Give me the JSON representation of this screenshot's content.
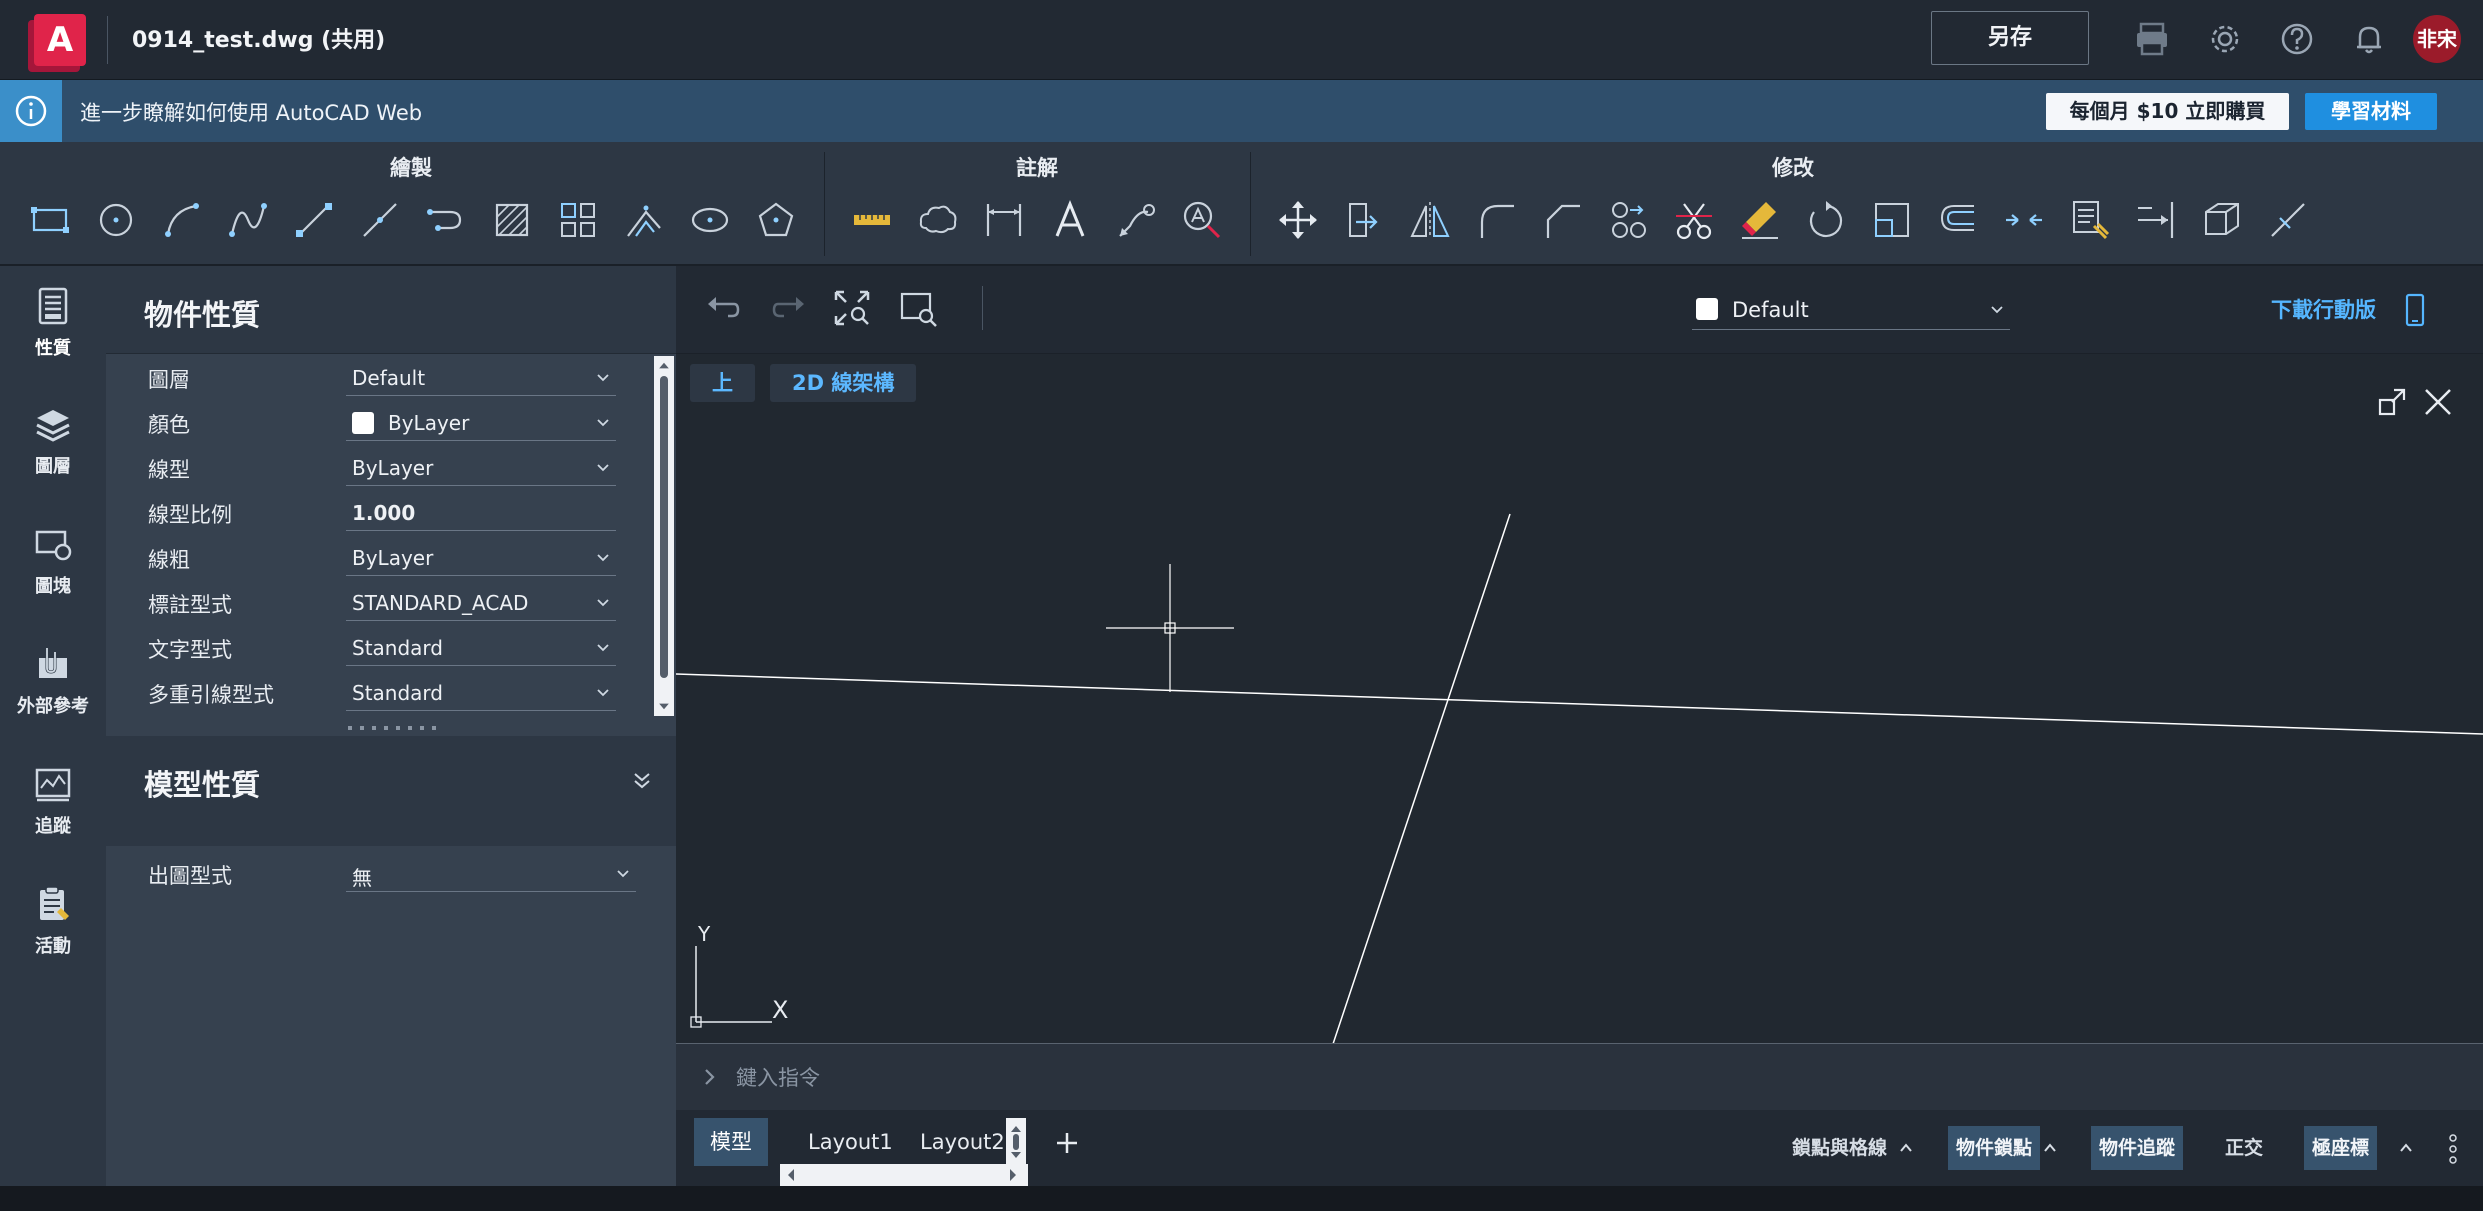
{
  "app": {
    "logo_letter": "A",
    "document_title": "0914_test.dwg (共用)",
    "save_as_label": "另存",
    "avatar_initials": "非宋"
  },
  "banner": {
    "text": "進一步瞭解如何使用 AutoCAD Web",
    "buy_label": "每個月 $10 立即購買",
    "learn_label": "學習材料"
  },
  "ribbon": {
    "groups": [
      {
        "title": "繪製",
        "tools": [
          "rectangle",
          "circle",
          "arc",
          "spline",
          "line",
          "ray",
          "polyline",
          "hatch",
          "array",
          "offset-trace",
          "ellipse",
          "polygon"
        ]
      },
      {
        "title": "註解",
        "tools": [
          "measure",
          "revision-cloud",
          "dimension",
          "text",
          "leader",
          "find-text"
        ]
      },
      {
        "title": "修改",
        "tools": [
          "move",
          "copy",
          "mirror",
          "fillet",
          "chamfer",
          "join",
          "trim",
          "erase",
          "rotate",
          "scale",
          "offset",
          "break",
          "match-properties",
          "extend",
          "3d-box",
          "explode"
        ]
      }
    ]
  },
  "rail": {
    "items": [
      {
        "label": "性質",
        "icon": "properties-icon"
      },
      {
        "label": "圖層",
        "icon": "layers-icon"
      },
      {
        "label": "圖塊",
        "icon": "blocks-icon"
      },
      {
        "label": "外部參考",
        "icon": "xref-icon"
      },
      {
        "label": "追蹤",
        "icon": "trace-icon"
      },
      {
        "label": "活動",
        "icon": "activity-icon"
      }
    ]
  },
  "properties": {
    "title": "物件性質",
    "rows": [
      {
        "label": "圖層",
        "value": "Default",
        "dropdown": true
      },
      {
        "label": "顏色",
        "value": "ByLayer",
        "dropdown": true,
        "swatch": "#ffffff"
      },
      {
        "label": "線型",
        "value": "ByLayer",
        "dropdown": true
      },
      {
        "label": "線型比例",
        "value": "1.000",
        "dropdown": false
      },
      {
        "label": "線粗",
        "value": "ByLayer",
        "dropdown": true
      },
      {
        "label": "標註型式",
        "value": "STANDARD_ACAD",
        "dropdown": true
      },
      {
        "label": "文字型式",
        "value": "Standard",
        "dropdown": true
      },
      {
        "label": "多重引線型式",
        "value": "Standard",
        "dropdown": true
      }
    ]
  },
  "model_properties": {
    "title": "模型性質",
    "rows": [
      {
        "label": "出圖型式",
        "value": "無"
      }
    ]
  },
  "canvas": {
    "layer_name": "Default",
    "download_mobile_label": "下載行動版",
    "view_label": "上",
    "visual_style_label": "2D 線架構",
    "ucs_y": "Y",
    "ucs_x": "X"
  },
  "command": {
    "placeholder": "鍵入指令"
  },
  "layouts": {
    "tabs": [
      "模型",
      "Layout1",
      "Layout2"
    ],
    "active": 0
  },
  "statusbar": {
    "items": [
      {
        "label": "鎖點與格線",
        "on": false
      },
      {
        "label": "物件鎖點",
        "on": true
      },
      {
        "label": "物件追蹤",
        "on": true
      },
      {
        "label": "正交",
        "on": false
      },
      {
        "label": "極座標",
        "on": true
      }
    ]
  },
  "colors": {
    "accent_blue": "#1f8fe0",
    "brand_red": "#e0244a",
    "link_blue": "#55b6ff"
  }
}
